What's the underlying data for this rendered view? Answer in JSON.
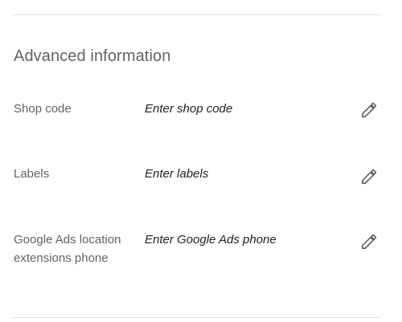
{
  "section": {
    "title": "Advanced information"
  },
  "fields": [
    {
      "label": "Shop code",
      "placeholder": "Enter shop code",
      "icon": "pencil-icon"
    },
    {
      "label": "Labels",
      "placeholder": "Enter labels",
      "icon": "pencil-icon"
    },
    {
      "label": "Google Ads location extensions phone",
      "placeholder": "Enter Google Ads phone",
      "icon": "pencil-icon"
    }
  ],
  "colors": {
    "label": "#5f6368",
    "value": "#202124",
    "icon": "#5f6368",
    "divider": "#e0e0e0"
  }
}
